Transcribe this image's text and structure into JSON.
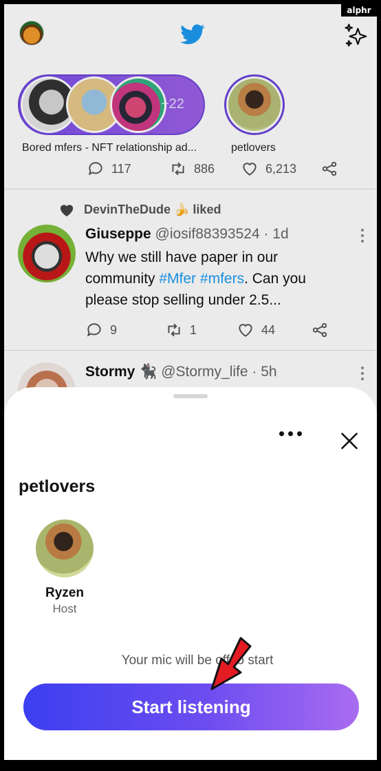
{
  "watermark": "alphr",
  "colors": {
    "twitter_blue": "#1d9bf0",
    "space_purple": "#7b4fe8",
    "button_gradient_start": "#3c3ff0",
    "button_gradient_end": "#a96cf0",
    "annotation_red": "#e31b23"
  },
  "header": {
    "profile_icon": "profile-avatar",
    "logo_icon": "twitter-bird-icon",
    "top_tweets_icon": "sparkle-icon"
  },
  "spaces": [
    {
      "label": "Bored mfers - NFT relationship ad...",
      "extra_count": "+22"
    },
    {
      "label": "petlovers"
    }
  ],
  "feed": {
    "prev_tweet_stats": {
      "replies": "117",
      "retweets": "886",
      "likes": "6,213"
    },
    "tweet1": {
      "liked_by": "DevinTheDude 🍌 liked",
      "name": "Giuseppe",
      "handle": "@iosif88393524 · 1d",
      "text_before": "Why we still have paper in our community ",
      "hashtag1": "#Mfer",
      "hashtag2": "#mfers",
      "text_after": ". Can you please stop selling under 2.5...",
      "replies": "9",
      "retweets": "1",
      "likes": "44"
    },
    "tweet2": {
      "name": "Stormy 🐈‍⬛",
      "handle": "@Stormy_life · 5h"
    }
  },
  "sheet": {
    "title": "petlovers",
    "host_name": "Ryzen",
    "host_role": "Host",
    "mic_note": "Your mic will be off to start",
    "start_button": "Start listening"
  }
}
